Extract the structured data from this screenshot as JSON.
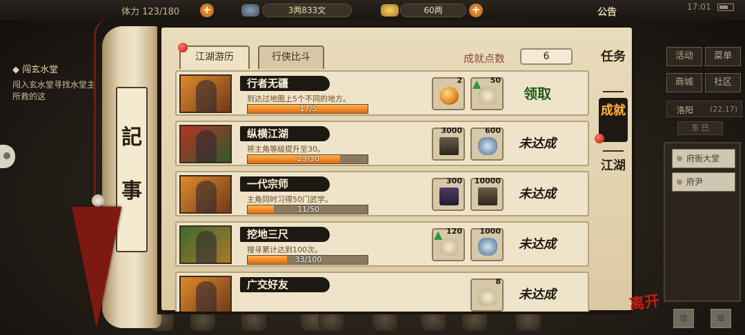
{
  "topbar": {
    "stat_partial": "体力 123/180",
    "copper": "3两833文",
    "silver": "60两",
    "announce": "公告",
    "clock": "17:01"
  },
  "left_quest": {
    "title": "◆ 闯玄水堂",
    "desc": "闯入玄水堂寻找水堂主所救的这"
  },
  "right_panel": {
    "buttons": [
      "活动",
      "菜单",
      "商城",
      "社区"
    ],
    "location": "洛阳",
    "coord": "(22,17)",
    "location_sub": "东 巳",
    "npcs": [
      "府衙大堂",
      "府尹"
    ],
    "small_buttons": [
      "信",
      "组"
    ]
  },
  "bottom_icons": [
    "角色",
    "包裹",
    "武学",
    "秘籍",
    "门派",
    "帮派",
    "交易",
    "记事",
    "地图"
  ],
  "scroll": {
    "char1": "記",
    "char2": "事"
  },
  "tabs": {
    "jianghu": "江湖游历",
    "xingxia": "行侠比斗"
  },
  "achievement": {
    "label": "成就点数",
    "value": "6"
  },
  "categories": {
    "quest": "任务",
    "achievement": "成就",
    "jianghu": "江湖"
  },
  "leave": "离开",
  "rows": [
    {
      "title": "行者无疆",
      "desc": "到达过地图上5个不同的地方。",
      "progress_text": "17/5",
      "progress": 1.0,
      "rewards": [
        {
          "icon": "orb-icon",
          "qty": "2"
        },
        {
          "icon": "dumpling-exp-icon",
          "qty": "50"
        }
      ],
      "status": "领取",
      "claimable": true
    },
    {
      "title": "纵横江湖",
      "desc": "将主角等级提升至30。",
      "progress_text": "23/30",
      "progress": 0.77,
      "rewards": [
        {
          "icon": "book-experience-icon",
          "qty": "3000"
        },
        {
          "icon": "silver-ingot-icon",
          "qty": "600"
        }
      ],
      "status": "未达成",
      "claimable": false
    },
    {
      "title": "一代宗师",
      "desc": "主角同时习得50门武学。",
      "progress_text": "11/50",
      "progress": 0.22,
      "rewards": [
        {
          "icon": "scroll-icon",
          "qty": "300"
        },
        {
          "icon": "book-experience-icon",
          "qty": "10000"
        }
      ],
      "status": "未达成",
      "claimable": false
    },
    {
      "title": "挖地三尺",
      "desc": "搜寻累计达到100次。",
      "progress_text": "33/100",
      "progress": 0.33,
      "rewards": [
        {
          "icon": "dumpling-exp-icon",
          "qty": "120"
        },
        {
          "icon": "silver-ingot-icon",
          "qty": "1000"
        }
      ],
      "status": "未达成",
      "claimable": false
    },
    {
      "title": "广交好友",
      "desc": "",
      "progress_text": "",
      "progress": 0,
      "rewards": [
        {
          "icon": "reward-icon",
          "qty": "8"
        }
      ],
      "status": "未达成",
      "claimable": false
    }
  ]
}
